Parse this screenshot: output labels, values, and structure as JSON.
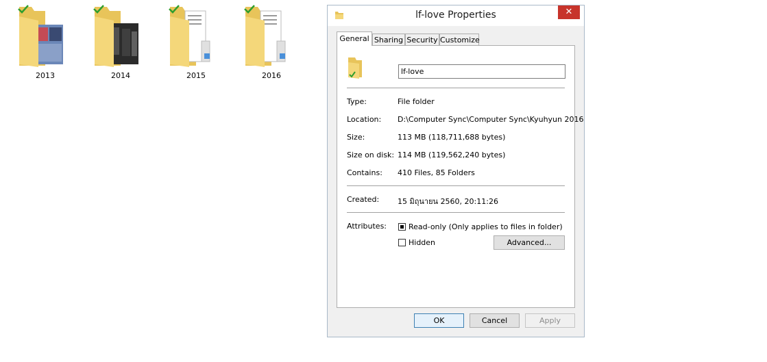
{
  "desktop": {
    "folders": [
      {
        "label": "2013",
        "style": "photo-blue"
      },
      {
        "label": "2014",
        "style": "photo-dark"
      },
      {
        "label": "2015",
        "style": "docs"
      },
      {
        "label": "2016",
        "style": "docs"
      }
    ]
  },
  "dialog": {
    "title": "lf-love Properties",
    "close_label": "✕",
    "tabs": [
      "General",
      "Sharing",
      "Security",
      "Customize"
    ],
    "active_tab": "General",
    "name_value": "lf-love",
    "rows": {
      "type": {
        "label": "Type:",
        "value": "File folder"
      },
      "location": {
        "label": "Location:",
        "value": "D:\\Computer Sync\\Computer Sync\\Kyuhyun 2016"
      },
      "size": {
        "label": "Size:",
        "value": "113 MB (118,711,688 bytes)"
      },
      "size_on_disk": {
        "label": "Size on disk:",
        "value": "114 MB (119,562,240 bytes)"
      },
      "contains": {
        "label": "Contains:",
        "value": "410 Files, 85 Folders"
      },
      "created": {
        "label": "Created:",
        "value": "15 มิถุนายน 2560, 20:11:26"
      }
    },
    "attributes": {
      "label": "Attributes:",
      "readonly_label": "Read-only (Only applies to files in folder)",
      "readonly_checked": true,
      "hidden_label": "Hidden",
      "hidden_checked": false,
      "advanced_label": "Advanced..."
    },
    "buttons": {
      "ok": "OK",
      "cancel": "Cancel",
      "apply": "Apply"
    }
  },
  "colors": {
    "close": "#c7342b",
    "folder": "#f4d77a",
    "check": "#2f9e2f"
  }
}
